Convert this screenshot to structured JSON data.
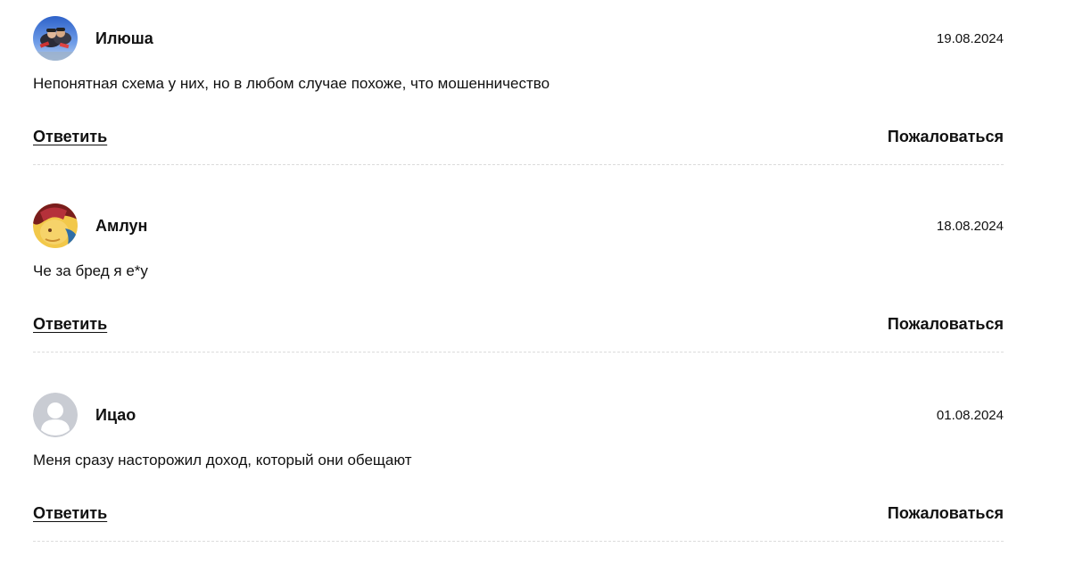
{
  "comments": [
    {
      "author": "Илюша",
      "date": "19.08.2024",
      "text": "Непонятная схема у них, но в любом случае похоже, что мошенничество",
      "reply_label": "Ответить",
      "report_label": "Пожаловаться",
      "avatar": "user-photo-skydiving"
    },
    {
      "author": "Амлун",
      "date": "18.08.2024",
      "text": "Че за бред я е*у",
      "reply_label": "Ответить",
      "report_label": "Пожаловаться",
      "avatar": "user-photo"
    },
    {
      "author": "Ицао",
      "date": "01.08.2024",
      "text": "Меня сразу насторожил доход, который они обещают",
      "reply_label": "Ответить",
      "report_label": "Пожаловаться",
      "avatar": "default-avatar-icon"
    }
  ],
  "colors": {
    "text": "#111111",
    "divider": "#dcdcdc",
    "default_avatar_bg": "#c9ccd3",
    "default_avatar_fg": "#ffffff"
  }
}
